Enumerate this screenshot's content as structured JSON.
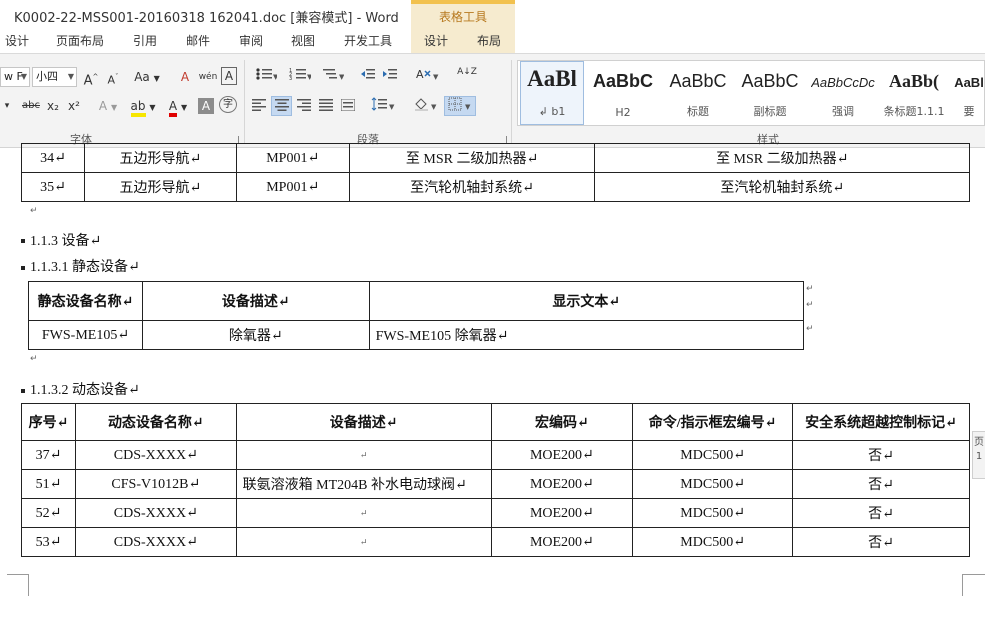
{
  "window": {
    "title": "K0002-22-MSS001-20160318 162041.doc [兼容模式] - Word",
    "context_group": "表格工具"
  },
  "tabs": [
    "设计",
    "页面布局",
    "引用",
    "邮件",
    "审阅",
    "视图",
    "开发工具",
    "设计",
    "布局"
  ],
  "ribbon": {
    "font": {
      "name": "w F",
      "size": "小四",
      "grow": "A",
      "shrink": "A",
      "case": "Aa",
      "clear_format": "A",
      "phonetic": "wén",
      "char_border": "A",
      "strike": "abc",
      "subscript": "x₂",
      "superscript": "x²",
      "text_effect": "A",
      "highlight": "ab",
      "font_color": "A",
      "char_shading": "A",
      "enclose": "字",
      "label": "字体"
    },
    "paragraph": {
      "label": "段落",
      "sort": "A↓Z"
    },
    "styles": {
      "label": "样式",
      "items": [
        {
          "sample": "AaBl",
          "name": "↲ b1"
        },
        {
          "sample": "AaBbC",
          "name": "H2"
        },
        {
          "sample": "AaBbC",
          "name": "标题"
        },
        {
          "sample": "AaBbC",
          "name": "副标题"
        },
        {
          "sample": "AaBbCcDc",
          "name": "强调"
        },
        {
          "sample": "AaBb(",
          "name": "条标题1.1.1"
        },
        {
          "sample": "AaBl",
          "name": "要"
        }
      ]
    }
  },
  "document": {
    "top_table": {
      "rows": [
        [
          "34↵",
          "五边形导航↵",
          "MP001↵",
          "至 MSR 二级加热器↵",
          "至 MSR 二级加热器↵"
        ],
        [
          "35↵",
          "五边形导航↵",
          "MP001↵",
          "至汽轮机轴封系统↵",
          "至汽轮机轴封系统↵"
        ]
      ]
    },
    "heading_1": "1.1.3   设备↵",
    "heading_2": "1.1.3.1 静态设备↵",
    "static_table": {
      "headers": [
        "静态设备名称↵",
        "设备描述↵",
        "显示文本↵"
      ],
      "rows": [
        [
          "FWS-ME105↵",
          "除氧器↵",
          "FWS-ME105  除氧器↵"
        ]
      ]
    },
    "heading_3": "1.1.3.2 动态设备↵",
    "dynamic_table": {
      "headers": [
        "序号↵",
        "动态设备名称↵",
        "设备描述↵",
        "宏编码↵",
        "命令/指示框宏编号↵",
        "安全系统超越控制标记↵"
      ],
      "rows": [
        [
          "37↵",
          "CDS-XXXX↵",
          "↵",
          "MOE200↵",
          "MDC500↵",
          "否↵"
        ],
        [
          "51↵",
          "CFS-V1012B↵",
          "联氨溶液箱 MT204B 补水电动球阀↵",
          "MOE200↵",
          "MDC500↵",
          "否↵"
        ],
        [
          "52↵",
          "CDS-XXXX↵",
          "↵",
          "MOE200↵",
          "MDC500↵",
          "否↵"
        ],
        [
          "53↵",
          "CDS-XXXX↵",
          "↵",
          "MOE200↵",
          "MDC500↵",
          "否↵"
        ]
      ]
    },
    "side_tab": {
      "line1": "页",
      "line2": "1"
    }
  }
}
